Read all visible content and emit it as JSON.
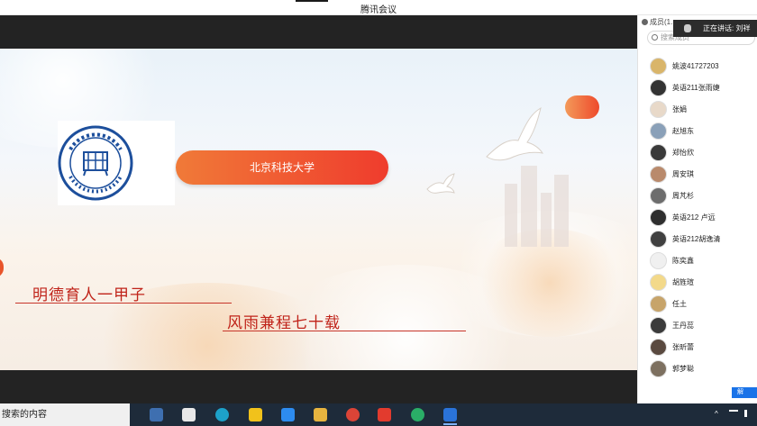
{
  "window": {
    "title": "腾讯会议"
  },
  "slide": {
    "badge": "北京科技大学",
    "slogan_line1": "明德育人一甲子",
    "slogan_line2": "风雨兼程七十载"
  },
  "speaker_banner": {
    "text": "正在讲话: 刘祥"
  },
  "panel": {
    "header": "成员(1…",
    "search_placeholder": "搜索成员",
    "members": [
      {
        "name": "姚波41727203",
        "color": "#d9b56a"
      },
      {
        "name": "英语211张雨婕",
        "color": "#333333"
      },
      {
        "name": "张娟",
        "color": "#e8d9c9"
      },
      {
        "name": "赵旭东",
        "color": "#8aa0b8"
      },
      {
        "name": "郑怡欣",
        "color": "#3a3a3a"
      },
      {
        "name": "周安琪",
        "color": "#b98a6c"
      },
      {
        "name": "周芃杉",
        "color": "#6d6d6d"
      },
      {
        "name": "英语212 卢远",
        "color": "#2f2f2f"
      },
      {
        "name": "英语212胡逸清",
        "color": "#404040"
      },
      {
        "name": "陈奕鑫",
        "color": "#f0f0f0"
      },
      {
        "name": "胡旌瑄",
        "color": "#f3d98a"
      },
      {
        "name": "任土",
        "color": "#c7a46a"
      },
      {
        "name": "王丹蕊",
        "color": "#3b3b3b"
      },
      {
        "name": "张昕蕾",
        "color": "#5a4a40"
      },
      {
        "name": "郭梦聪",
        "color": "#7d7060"
      }
    ],
    "confirm_label": "解"
  },
  "taskbar": {
    "search_text": "搜索的内容",
    "clock_text": "^"
  }
}
